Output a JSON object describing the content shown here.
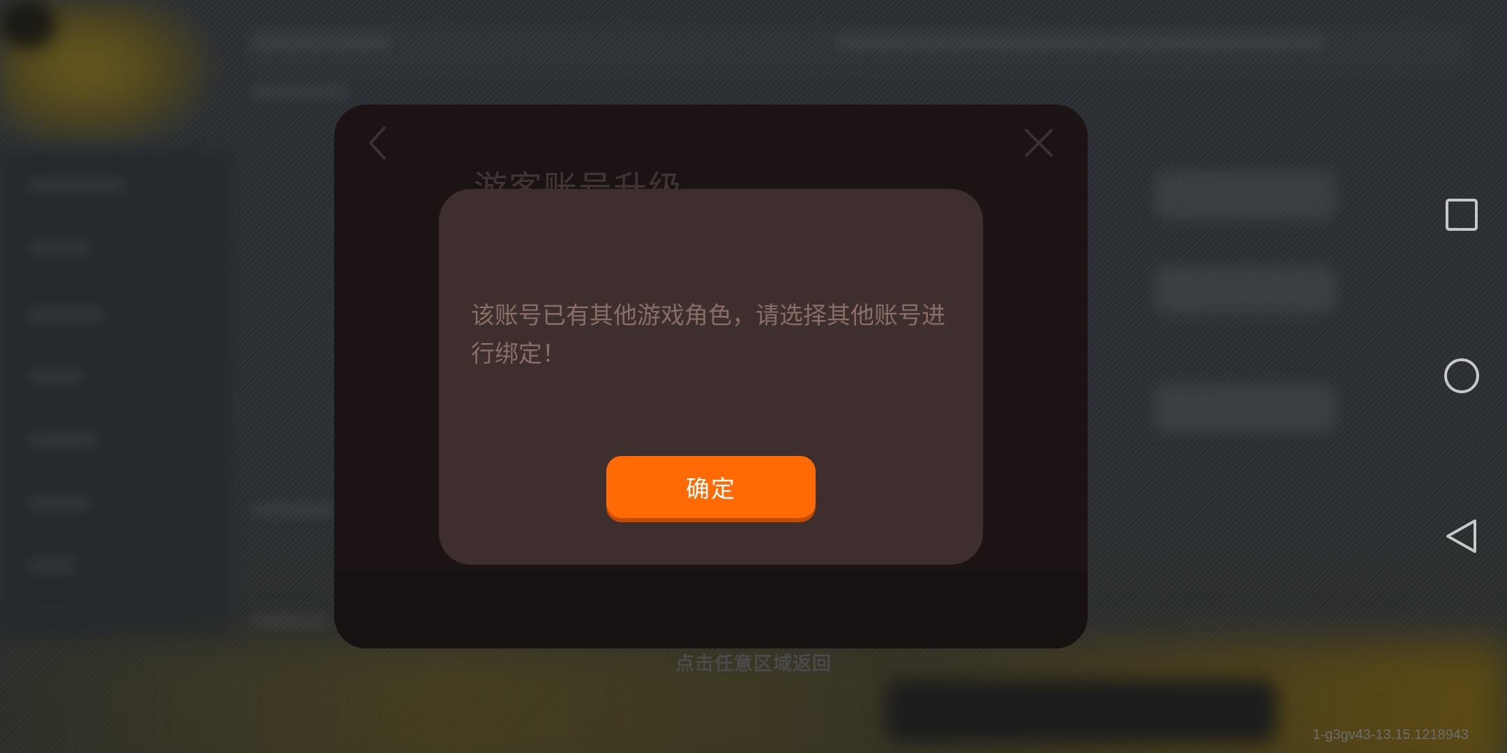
{
  "background": {
    "tap_to_return": "点击任意区域返回"
  },
  "panel": {
    "title": "游客账号升级",
    "back_icon": "chevron-left-icon",
    "close_icon": "close-icon"
  },
  "dialog": {
    "message": "该账号已有其他游戏角色，请选择其他账号进行绑定！",
    "confirm_label": "确定"
  },
  "footer": {
    "version": "1-g3gv43-13.15.1218943"
  },
  "navbar": {
    "items": [
      "recents-icon",
      "home-icon",
      "back-icon"
    ]
  },
  "colors": {
    "accent": "#ff6a05",
    "dialog_bg": "#3e2e2d",
    "panel_bg": "#1c1414",
    "message_text": "#8a6d66"
  }
}
